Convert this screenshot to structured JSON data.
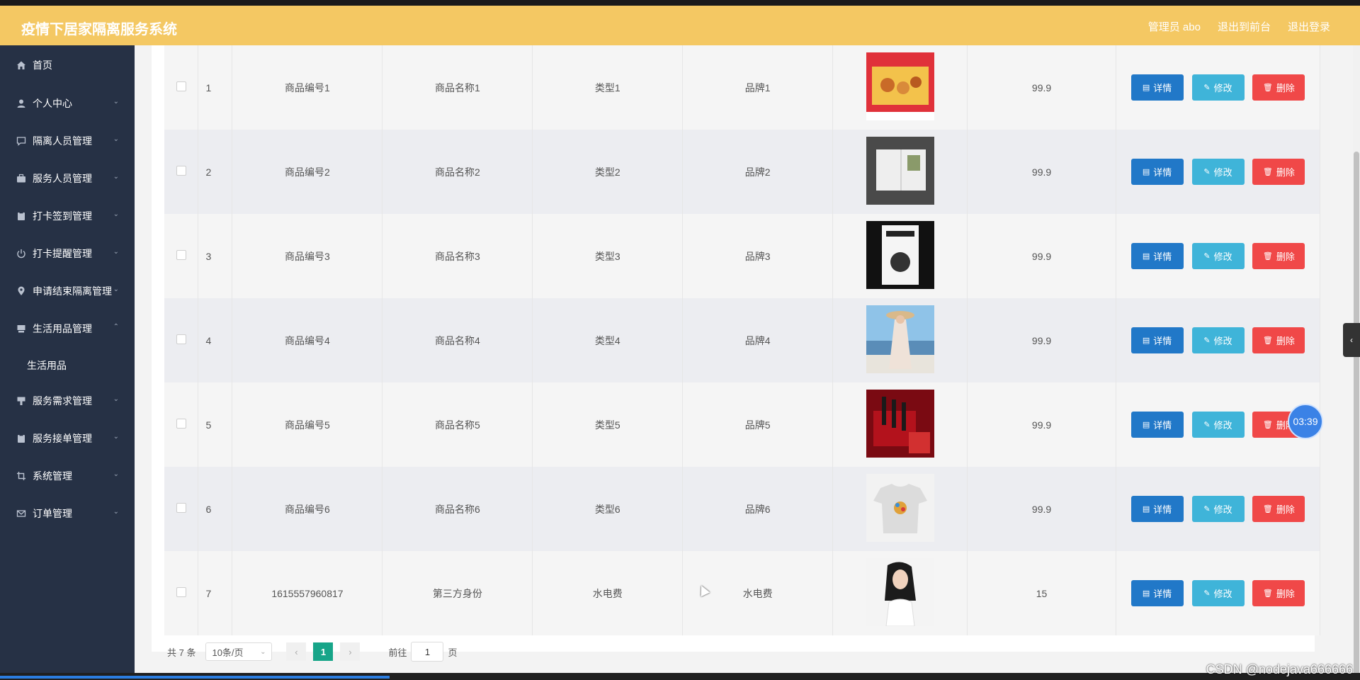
{
  "header": {
    "title": "疫情下居家隔离服务系统",
    "user": "管理员 abo",
    "to_front": "退出到前台",
    "logout": "退出登录"
  },
  "sidebar": {
    "items": [
      {
        "label": "首页",
        "icon": "home-icon"
      },
      {
        "label": "个人中心",
        "icon": "user-icon"
      },
      {
        "label": "隔离人员管理",
        "icon": "chat-icon"
      },
      {
        "label": "服务人员管理",
        "icon": "briefcase-icon"
      },
      {
        "label": "打卡签到管理",
        "icon": "clipboard-icon"
      },
      {
        "label": "打卡提醒管理",
        "icon": "power-icon"
      },
      {
        "label": "申请结束隔离管理",
        "icon": "location-icon"
      },
      {
        "label": "生活用品管理",
        "icon": "box-icon"
      },
      {
        "label": "服务需求管理",
        "icon": "flag-icon"
      },
      {
        "label": "服务接单管理",
        "icon": "clipboard-icon"
      },
      {
        "label": "系统管理",
        "icon": "crop-icon"
      },
      {
        "label": "订单管理",
        "icon": "mail-icon"
      }
    ],
    "sub_item": "生活用品"
  },
  "table": {
    "rows": [
      {
        "no": "1",
        "code": "商品编号1",
        "name": "商品名称1",
        "type": "类型1",
        "brand": "品牌1",
        "price": "99.9"
      },
      {
        "no": "2",
        "code": "商品编号2",
        "name": "商品名称2",
        "type": "类型2",
        "brand": "品牌2",
        "price": "99.9"
      },
      {
        "no": "3",
        "code": "商品编号3",
        "name": "商品名称3",
        "type": "类型3",
        "brand": "品牌3",
        "price": "99.9"
      },
      {
        "no": "4",
        "code": "商品编号4",
        "name": "商品名称4",
        "type": "类型4",
        "brand": "品牌4",
        "price": "99.9"
      },
      {
        "no": "5",
        "code": "商品编号5",
        "name": "商品名称5",
        "type": "类型5",
        "brand": "品牌5",
        "price": "99.9"
      },
      {
        "no": "6",
        "code": "商品编号6",
        "name": "商品名称6",
        "type": "类型6",
        "brand": "品牌6",
        "price": "99.9"
      },
      {
        "no": "7",
        "code": "1615557960817",
        "name": "第三方身份",
        "type": "水电费",
        "brand": "水电费",
        "price": "15"
      }
    ],
    "actions": {
      "detail": "详情",
      "edit": "修改",
      "delete": "删除"
    }
  },
  "pager": {
    "total": "共 7 条",
    "page_size": "10条/页",
    "current": "1",
    "goto_label": "前往",
    "goto_value": "1",
    "unit": "页"
  },
  "timer": "03:39",
  "watermark": "CSDN @nodejava666666"
}
